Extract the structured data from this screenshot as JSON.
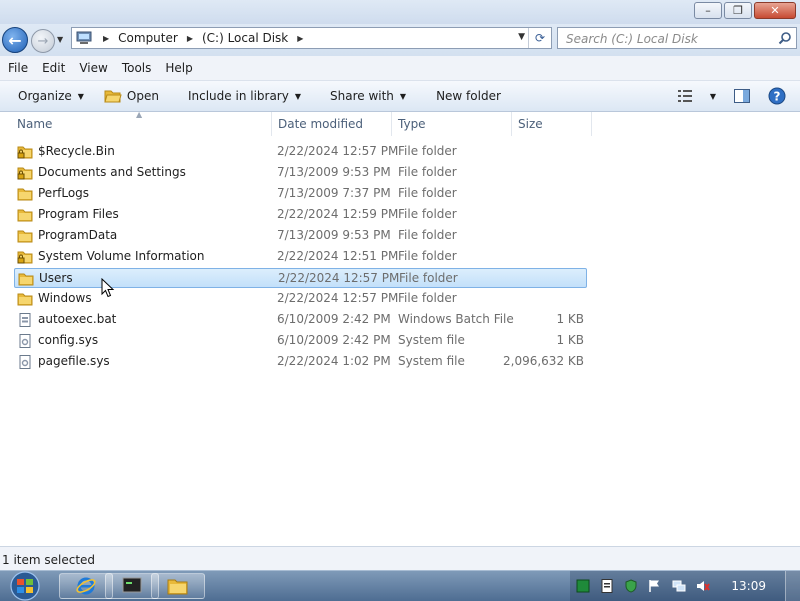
{
  "window": {
    "minimize_glyph": "–",
    "maximize_glyph": "❐",
    "close_glyph": "✕"
  },
  "nav": {
    "back_glyph": "←",
    "forward_glyph": "→"
  },
  "address": {
    "crumbs": [
      "Computer",
      "(C:) Local Disk"
    ],
    "refresh_glyph": "⟳"
  },
  "search": {
    "placeholder": "Search (C:) Local Disk"
  },
  "menubar": {
    "items": [
      "File",
      "Edit",
      "View",
      "Tools",
      "Help"
    ]
  },
  "commandbar": {
    "organize": "Organize",
    "open": "Open",
    "include_in_library": "Include in library",
    "share_with": "Share with",
    "new_folder": "New folder"
  },
  "columns": {
    "name": "Name",
    "date_modified": "Date modified",
    "type": "Type",
    "size": "Size"
  },
  "files": [
    {
      "name": "$Recycle.Bin",
      "date": "2/22/2024 12:57 PM",
      "type": "File folder",
      "size": "",
      "icon": "locked-folder-icon"
    },
    {
      "name": "Documents and Settings",
      "date": "7/13/2009 9:53 PM",
      "type": "File folder",
      "size": "",
      "icon": "locked-folder-icon"
    },
    {
      "name": "PerfLogs",
      "date": "7/13/2009 7:37 PM",
      "type": "File folder",
      "size": "",
      "icon": "folder-icon"
    },
    {
      "name": "Program Files",
      "date": "2/22/2024 12:59 PM",
      "type": "File folder",
      "size": "",
      "icon": "folder-icon"
    },
    {
      "name": "ProgramData",
      "date": "7/13/2009 9:53 PM",
      "type": "File folder",
      "size": "",
      "icon": "folder-icon"
    },
    {
      "name": "System Volume Information",
      "date": "2/22/2024 12:51 PM",
      "type": "File folder",
      "size": "",
      "icon": "locked-folder-icon"
    },
    {
      "name": "Users",
      "date": "2/22/2024 12:57 PM",
      "type": "File folder",
      "size": "",
      "icon": "folder-icon",
      "selected": true
    },
    {
      "name": "Windows",
      "date": "2/22/2024 12:57 PM",
      "type": "File folder",
      "size": "",
      "icon": "folder-icon"
    },
    {
      "name": "autoexec.bat",
      "date": "6/10/2009 2:42 PM",
      "type": "Windows Batch File",
      "size": "1 KB",
      "icon": "batch-file-icon"
    },
    {
      "name": "config.sys",
      "date": "6/10/2009 2:42 PM",
      "type": "System file",
      "size": "1 KB",
      "icon": "system-file-icon"
    },
    {
      "name": "pagefile.sys",
      "date": "2/22/2024 1:02 PM",
      "type": "System file",
      "size": "2,096,632 KB",
      "icon": "system-file-icon"
    }
  ],
  "status": {
    "text": "1 item selected"
  },
  "taskbar": {
    "apps": [
      "internet-explorer",
      "command-prompt",
      "windows-explorer"
    ],
    "clock": "13:09"
  },
  "colors": {
    "selection_fill": "#c3e0fa",
    "selection_border": "#7fb2e6",
    "folder": "#f2c94c",
    "accent": "#1e5fb5"
  }
}
